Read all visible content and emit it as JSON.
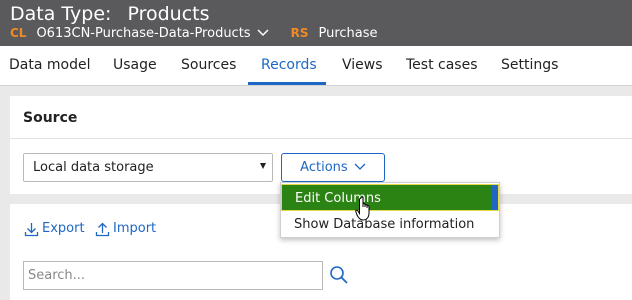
{
  "header": {
    "title_prefix": "Data Type:",
    "title": "Products",
    "cl_tag": "CL",
    "class_name": "O613CN-Purchase-Data-Products",
    "rs_tag": "RS",
    "ruleset": "Purchase"
  },
  "tabs": [
    {
      "label": "Data model"
    },
    {
      "label": "Usage"
    },
    {
      "label": "Sources"
    },
    {
      "label": "Records",
      "active": true
    },
    {
      "label": "Views"
    },
    {
      "label": "Test cases"
    },
    {
      "label": "Settings"
    }
  ],
  "source": {
    "title": "Source",
    "select_value": "Local data storage",
    "actions_label": "Actions"
  },
  "actions_menu": {
    "items": [
      {
        "label": "Edit Columns",
        "highlighted": true
      },
      {
        "label": "Show Database information"
      }
    ]
  },
  "records": {
    "export_label": "Export",
    "import_label": "Import",
    "search_placeholder": "Search..."
  },
  "colors": {
    "header_bg": "#5a5a5c",
    "accent_blue": "#1f67c5",
    "tag_orange": "#f08a24",
    "menu_highlight": "#2b8314",
    "page_bg": "#e9e9ea"
  }
}
